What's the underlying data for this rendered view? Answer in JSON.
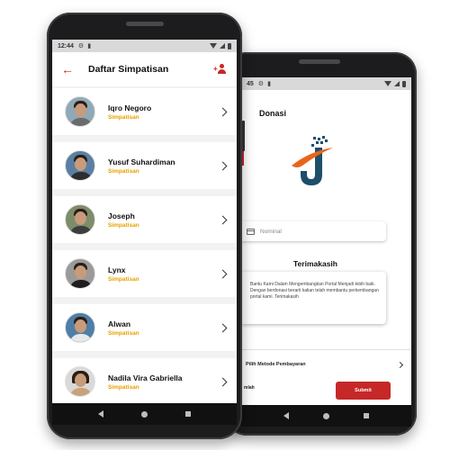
{
  "front_phone": {
    "status": {
      "time": "12:44"
    },
    "header": {
      "title": "Daftar Simpatisan"
    },
    "items": [
      {
        "name": "Iqro Negoro",
        "role": "Simpatisan"
      },
      {
        "name": "Yusuf Suhardiman",
        "role": "Simpatisan"
      },
      {
        "name": "Joseph",
        "role": "Simpatisan"
      },
      {
        "name": "Lynx",
        "role": "Simpatisan"
      },
      {
        "name": "Alwan",
        "role": "Simpatisan"
      },
      {
        "name": "Nadila Vira Gabriella",
        "role": "Simpatisan"
      }
    ]
  },
  "back_phone": {
    "status": {
      "time": "45"
    },
    "title": "Donasi",
    "nominal_placeholder": "Nominal",
    "thanks_title": "Terimakasih",
    "thanks_text": "Bantu Kami Dalam Mengembangkan Portal Menjadi lebih baik. Dengan berdonasi berarti kalian telah membantu perkembangan portal kami. Terimakasih",
    "payment_method_label": "Pilih Metode Pembayaran",
    "amount_label": "mlah",
    "submit_label": "Submit"
  },
  "colors": {
    "accent_red": "#c62828",
    "role_yellow": "#e6a100",
    "logo_navy": "#1f4e6b",
    "logo_orange": "#e8641b"
  },
  "icons": [
    "back-arrow-icon",
    "add-user-icon",
    "chevron-right-icon",
    "settings-icon",
    "card-icon",
    "nav-back-icon",
    "nav-home-icon",
    "nav-recent-icon"
  ]
}
